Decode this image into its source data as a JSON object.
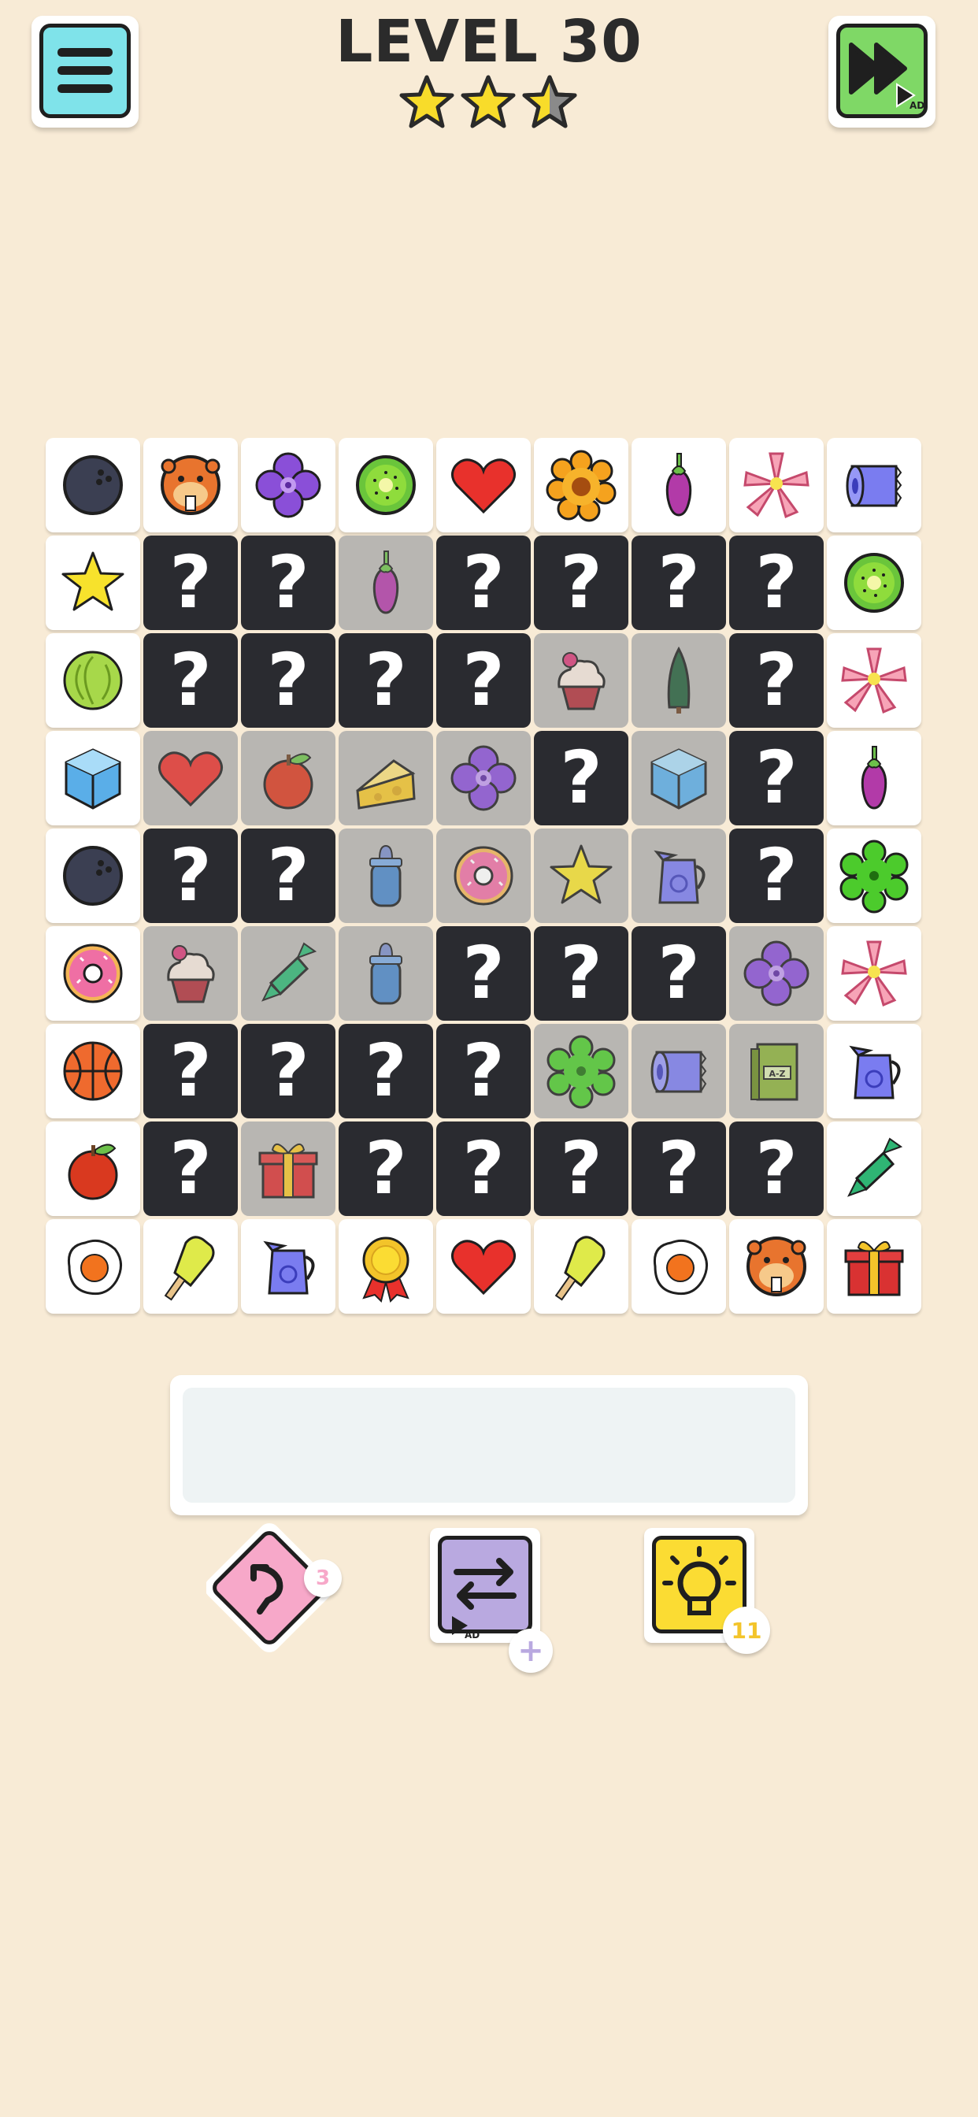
{
  "header": {
    "title": "LEVEL 30",
    "stars": {
      "filled": 2.5,
      "total": 3
    },
    "menu_icon": "hamburger-menu-icon",
    "skip_icon": "fast-forward-icon",
    "skip_ad_label": "AD"
  },
  "board": {
    "rows": [
      [
        {
          "s": "open",
          "i": "bowling-ball"
        },
        {
          "s": "open",
          "i": "beaver"
        },
        {
          "s": "open",
          "i": "purple-flower"
        },
        {
          "s": "open",
          "i": "kiwi"
        },
        {
          "s": "open",
          "i": "heart"
        },
        {
          "s": "open",
          "i": "orange-flower"
        },
        {
          "s": "open",
          "i": "eggplant"
        },
        {
          "s": "open",
          "i": "pink-lily"
        },
        {
          "s": "open",
          "i": "toilet-paper"
        }
      ],
      [
        {
          "s": "open",
          "i": "star"
        },
        {
          "s": "hidden"
        },
        {
          "s": "hidden"
        },
        {
          "s": "dim",
          "i": "eggplant"
        },
        {
          "s": "hidden"
        },
        {
          "s": "hidden"
        },
        {
          "s": "hidden"
        },
        {
          "s": "hidden"
        },
        {
          "s": "open",
          "i": "kiwi"
        }
      ],
      [
        {
          "s": "open",
          "i": "cabbage"
        },
        {
          "s": "hidden"
        },
        {
          "s": "hidden"
        },
        {
          "s": "hidden"
        },
        {
          "s": "hidden"
        },
        {
          "s": "dim",
          "i": "cupcake"
        },
        {
          "s": "dim",
          "i": "pine-tree"
        },
        {
          "s": "hidden"
        },
        {
          "s": "open",
          "i": "pink-lily"
        }
      ],
      [
        {
          "s": "open",
          "i": "ice-cube"
        },
        {
          "s": "dim",
          "i": "heart"
        },
        {
          "s": "dim",
          "i": "apple"
        },
        {
          "s": "dim",
          "i": "cheese"
        },
        {
          "s": "dim",
          "i": "purple-flower"
        },
        {
          "s": "hidden"
        },
        {
          "s": "dim",
          "i": "ice-cube"
        },
        {
          "s": "hidden"
        },
        {
          "s": "open",
          "i": "eggplant"
        }
      ],
      [
        {
          "s": "open",
          "i": "bowling-ball"
        },
        {
          "s": "hidden"
        },
        {
          "s": "hidden"
        },
        {
          "s": "dim",
          "i": "baby-bottle"
        },
        {
          "s": "dim",
          "i": "donut"
        },
        {
          "s": "dim",
          "i": "star"
        },
        {
          "s": "dim",
          "i": "jug"
        },
        {
          "s": "hidden"
        },
        {
          "s": "open",
          "i": "green-flower"
        }
      ],
      [
        {
          "s": "open",
          "i": "donut"
        },
        {
          "s": "dim",
          "i": "cupcake"
        },
        {
          "s": "dim",
          "i": "candy"
        },
        {
          "s": "dim",
          "i": "baby-bottle"
        },
        {
          "s": "hidden"
        },
        {
          "s": "hidden"
        },
        {
          "s": "hidden"
        },
        {
          "s": "dim",
          "i": "purple-flower"
        },
        {
          "s": "open",
          "i": "pink-lily"
        }
      ],
      [
        {
          "s": "open",
          "i": "basketball"
        },
        {
          "s": "hidden"
        },
        {
          "s": "hidden"
        },
        {
          "s": "hidden"
        },
        {
          "s": "hidden"
        },
        {
          "s": "dim",
          "i": "green-flower"
        },
        {
          "s": "dim",
          "i": "toilet-paper"
        },
        {
          "s": "dim",
          "i": "dictionary"
        },
        {
          "s": "open",
          "i": "jug"
        }
      ],
      [
        {
          "s": "open",
          "i": "apple"
        },
        {
          "s": "hidden"
        },
        {
          "s": "dim",
          "i": "gift"
        },
        {
          "s": "hidden"
        },
        {
          "s": "hidden"
        },
        {
          "s": "hidden"
        },
        {
          "s": "hidden"
        },
        {
          "s": "hidden"
        },
        {
          "s": "open",
          "i": "candy"
        }
      ],
      [
        {
          "s": "open",
          "i": "fried-egg"
        },
        {
          "s": "open",
          "i": "popsicle"
        },
        {
          "s": "open",
          "i": "jug"
        },
        {
          "s": "open",
          "i": "medal"
        },
        {
          "s": "open",
          "i": "heart"
        },
        {
          "s": "open",
          "i": "popsicle"
        },
        {
          "s": "open",
          "i": "fried-egg"
        },
        {
          "s": "open",
          "i": "beaver"
        },
        {
          "s": "open",
          "i": "gift"
        }
      ]
    ],
    "hidden_glyph": "?",
    "dictionary_label": "A-Z"
  },
  "tray": {
    "slots_filled": 0
  },
  "powerups": {
    "undo": {
      "icon": "undo-arrow-icon",
      "count": "3",
      "color": "#f7a8c9"
    },
    "shuffle": {
      "icon": "shuffle-arrows-icon",
      "ad_label": "AD",
      "badge_icon": "plus-icon",
      "color": "#b9a9e0"
    },
    "hint": {
      "icon": "lightbulb-icon",
      "count": "11",
      "color": "#fbdc33"
    }
  }
}
